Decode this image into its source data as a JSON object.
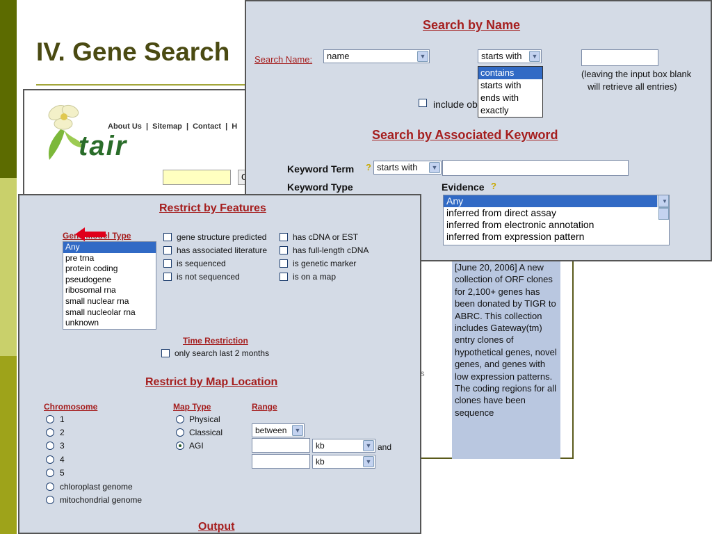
{
  "slide": {
    "title": "IV. Gene Search"
  },
  "tair": {
    "nav": [
      "About Us",
      "|",
      "Sitemap",
      "|",
      "Contact",
      "|",
      "H"
    ],
    "logo_text": "tair",
    "go_label": "G"
  },
  "news": {
    "text": "[June 20, 2006] A new collection of ORF clones for 2,100+ genes has been donated by TIGR to ABRC. This collection includes Gateway(tm) entry clones of hypothetical genes, novel genes, and genes with low expression patterns. The coding regions for all clones have been sequence",
    "side_fragment": "is"
  },
  "search_by_name": {
    "heading": "Search by Name",
    "search_name_label": "Search Name:",
    "field_select": "name",
    "match_select": "starts with",
    "match_options": [
      "contains",
      "starts with",
      "ends with",
      "exactly"
    ],
    "match_options_selected": "contains",
    "hint_line1": "(leaving the input box blank",
    "hint_line2": "will retrieve all entries)",
    "include_label": "include ob"
  },
  "search_by_keyword": {
    "heading": "Search by Associated Keyword",
    "keyword_term_label": "Keyword Term",
    "keyword_match": "starts with",
    "keyword_type_label": "Keyword Type",
    "evidence_label": "Evidence",
    "evidence_options": [
      "Any",
      "inferred from direct assay",
      "inferred from electronic annotation",
      "inferred from expression pattern"
    ],
    "evidence_selected": "Any"
  },
  "features": {
    "heading": "Restrict by Features",
    "gene_model_type_label": "Gene Model Type",
    "gene_model_types": [
      "Any",
      "pre trna",
      "protein coding",
      "pseudogene",
      "ribosomal rna",
      "small nuclear rna",
      "small nucleolar rna",
      "unknown"
    ],
    "gene_model_selected": "Any",
    "checks_col1": [
      "gene structure predicted",
      "has associated literature",
      "is sequenced",
      "is not sequenced"
    ],
    "checks_col2": [
      "has cDNA or EST",
      "has full-length cDNA",
      "is genetic marker",
      "is on a map"
    ],
    "time_restriction_label": "Time Restriction",
    "time_restriction_check": "only search last 2 months"
  },
  "map_location": {
    "heading": "Restrict by Map Location",
    "chromosome_label": "Chromosome",
    "chromosomes": [
      "1",
      "2",
      "3",
      "4",
      "5",
      "chloroplast genome",
      "mitochondrial genome"
    ],
    "map_type_label": "Map Type",
    "map_types": [
      "Physical",
      "Classical",
      "AGI"
    ],
    "map_type_selected": "AGI",
    "range_label": "Range",
    "range_mode": "between",
    "unit1": "kb",
    "unit2": "kb",
    "and_label": "and"
  },
  "output": {
    "heading": "Output"
  },
  "colors": {
    "panel_bg": "#d4dbe6",
    "heading_red": "#a51e1e",
    "selection_blue": "#316ac5",
    "title_olive": "#4a4a12",
    "bar_dark": "#5c6b00",
    "bar_light": "#c9d06b",
    "bar_mid": "#9ea31a",
    "news_bg": "#b9c7e0"
  }
}
